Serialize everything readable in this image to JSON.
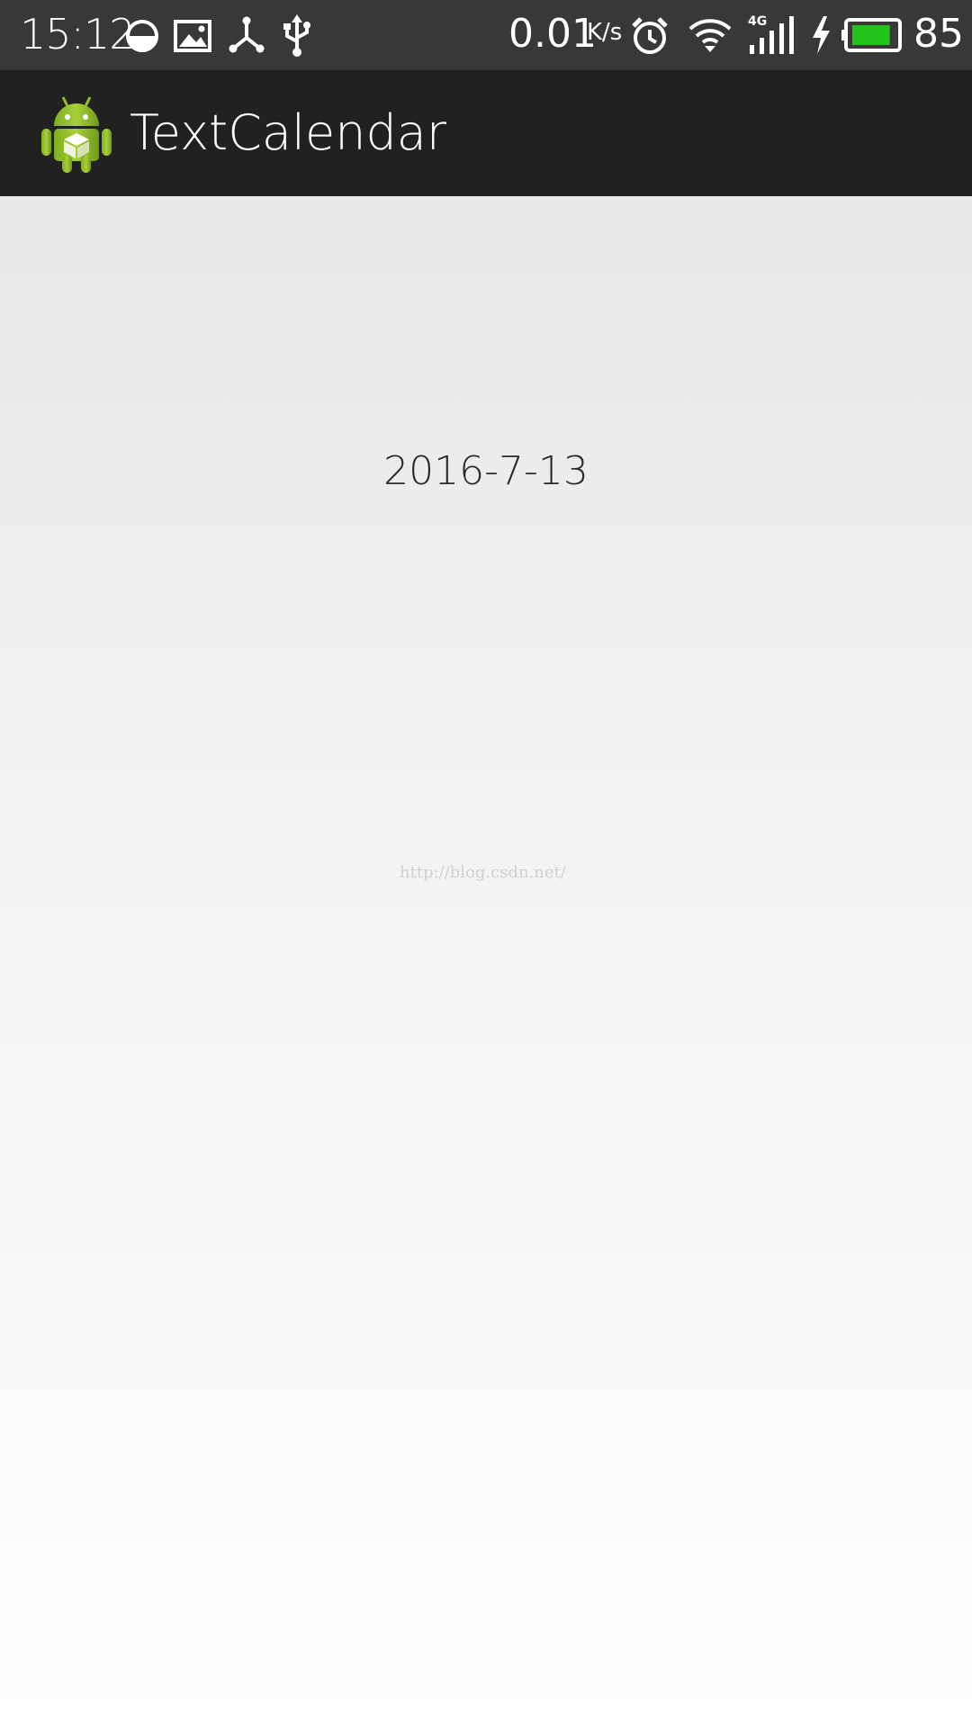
{
  "status_bar": {
    "time": "15:12",
    "network_speed": "0.01",
    "network_speed_unit": "K/s",
    "battery_level": "85",
    "battery_color": "#22c41b",
    "icons": [
      "data-saver-icon",
      "image-icon",
      "share-icon",
      "usb-icon",
      "alarm-icon",
      "wifi-icon",
      "signal-4g-icon",
      "charging-icon",
      "battery-icon"
    ]
  },
  "action_bar": {
    "title": "TextCalendar",
    "icon": "android-app-icon"
  },
  "main": {
    "date_text": "2016-7-13",
    "watermark": "http://blog.csdn.net/"
  }
}
